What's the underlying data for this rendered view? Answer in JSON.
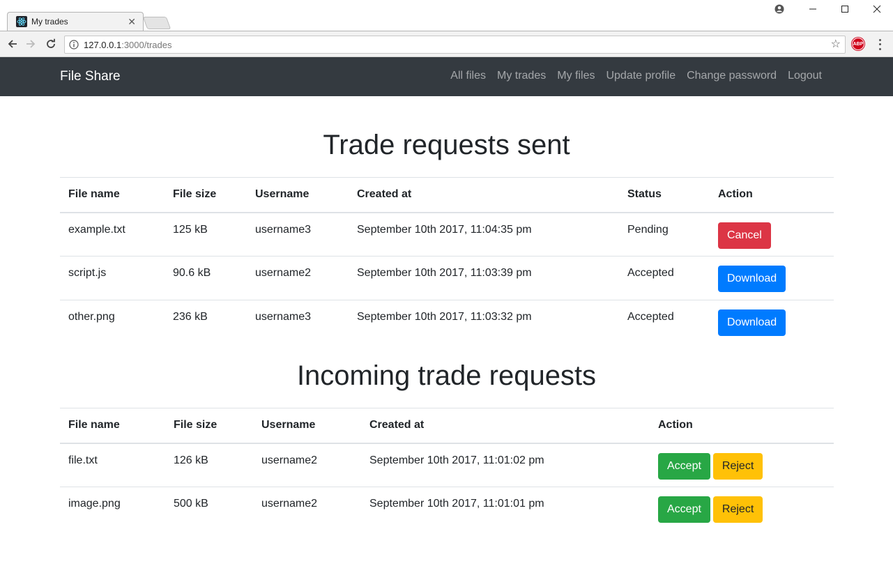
{
  "browser": {
    "tab_title": "My trades",
    "url_host": "127.0.0.1",
    "url_path": ":3000/trades",
    "abp_label": "ABP"
  },
  "navbar": {
    "brand": "File Share",
    "links": [
      "All files",
      "My trades",
      "My files",
      "Update profile",
      "Change password",
      "Logout"
    ]
  },
  "sent": {
    "title": "Trade requests sent",
    "columns": [
      "File name",
      "File size",
      "Username",
      "Created at",
      "Status",
      "Action"
    ],
    "rows": [
      {
        "file": "example.txt",
        "size": "125 kB",
        "user": "username3",
        "created": "September 10th 2017, 11:04:35 pm",
        "status": "Pending",
        "action": "Cancel"
      },
      {
        "file": "script.js",
        "size": "90.6 kB",
        "user": "username2",
        "created": "September 10th 2017, 11:03:39 pm",
        "status": "Accepted",
        "action": "Download"
      },
      {
        "file": "other.png",
        "size": "236 kB",
        "user": "username3",
        "created": "September 10th 2017, 11:03:32 pm",
        "status": "Accepted",
        "action": "Download"
      }
    ]
  },
  "incoming": {
    "title": "Incoming trade requests",
    "columns": [
      "File name",
      "File size",
      "Username",
      "Created at",
      "Action"
    ],
    "accept_label": "Accept",
    "reject_label": "Reject",
    "rows": [
      {
        "file": "file.txt",
        "size": "126 kB",
        "user": "username2",
        "created": "September 10th 2017, 11:01:02 pm"
      },
      {
        "file": "image.png",
        "size": "500 kB",
        "user": "username2",
        "created": "September 10th 2017, 11:01:01 pm"
      }
    ]
  },
  "colors": {
    "navbar_bg": "#343a40",
    "danger": "#dc3545",
    "primary": "#007bff",
    "success": "#28a745",
    "warning": "#ffc107"
  }
}
